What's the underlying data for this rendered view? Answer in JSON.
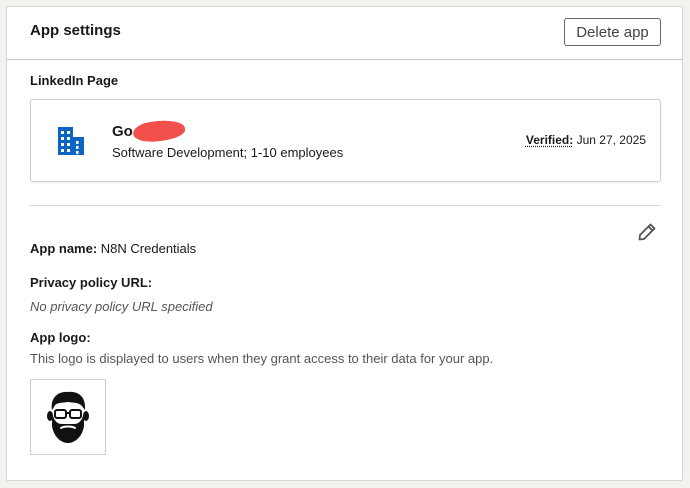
{
  "header": {
    "title": "App settings",
    "delete_label": "Delete app"
  },
  "linkedin_page": {
    "section_label": "LinkedIn Page",
    "icon": "building-icon",
    "company_name_visible": "Go",
    "company_meta": "Software Development; 1-10 employees",
    "verified_label": "Verified:",
    "verified_date": "Jun 27, 2025",
    "accent_color": "#0a66c2",
    "redaction_color": "#f2504b"
  },
  "details": {
    "edit_icon": "pencil-icon",
    "app_name_label": "App name:",
    "app_name_value": "N8N Credentials",
    "privacy_label": "Privacy policy URL:",
    "privacy_value": "No privacy policy URL specified",
    "logo_label": "App logo:",
    "logo_description": "This logo is displayed to users when they grant access to their data for your app.",
    "logo_icon": "bearded-man-avatar"
  }
}
